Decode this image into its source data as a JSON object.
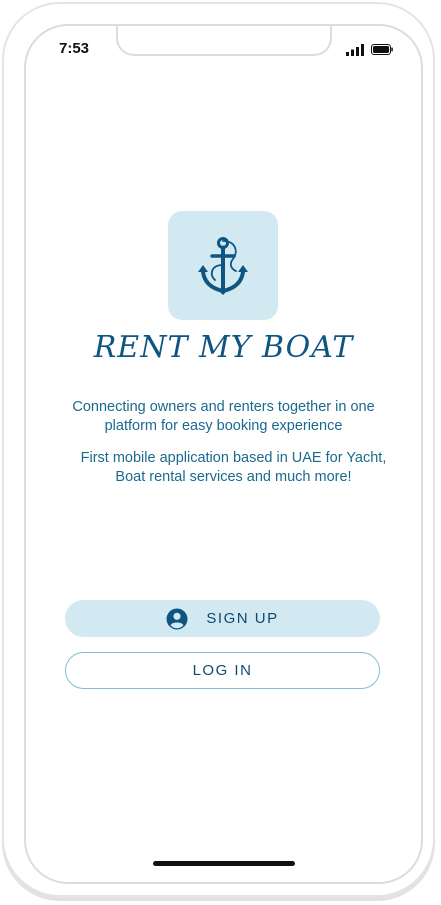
{
  "status_bar": {
    "time": "7:53",
    "signal_icon": "cellular-signal-icon",
    "battery_icon": "battery-icon"
  },
  "brand": {
    "logo_icon": "anchor-icon",
    "title": "RENT MY BOAT"
  },
  "taglines": {
    "line1": "Connecting owners and renters together in one platform for easy booking experience",
    "line2": "First mobile application based in UAE for Yacht, Boat rental services and much more!"
  },
  "actions": {
    "signup_label": "SIGN UP",
    "signup_icon": "account-circle-icon",
    "login_label": "LOG IN"
  },
  "colors": {
    "accent": "#0f5582",
    "accent_light": "#d3e9f2",
    "text": "#1a6a8e",
    "border": "#7fbfd0"
  }
}
